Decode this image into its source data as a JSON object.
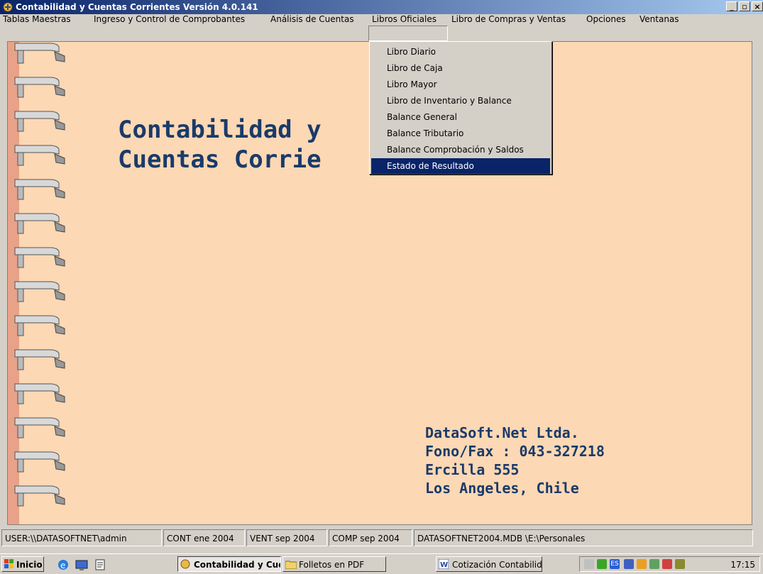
{
  "window": {
    "title": "Contabilidad y Cuentas Corrientes  Versión 4.0.141",
    "minimize": "_",
    "maximize": "▫",
    "close": "×"
  },
  "menubar": {
    "items": [
      "Tablas Maestras",
      "Ingreso y Control de Comprobantes",
      "Análisis de Cuentas",
      "Libros Oficiales",
      "Libro de Compras y Ventas",
      "Opciones",
      "Ventanas"
    ]
  },
  "dropdown": {
    "items": [
      "Libro Diario",
      "Libro de Caja",
      "Libro Mayor",
      "Libro de Inventario y Balance",
      "Balance General",
      "Balance Tributario",
      "Balance Comprobación y Saldos",
      "Estado de Resultado"
    ],
    "selected": "Estado de Resultado"
  },
  "main": {
    "heading_line1": "Contabilidad y",
    "heading_line2": "Cuentas Corrie",
    "company_lines": [
      "DataSoft.Net Ltda.",
      "Fono/Fax : 043-327218",
      "Ercilla 555",
      "Los Angeles, Chile"
    ]
  },
  "statusbar": {
    "panes": [
      "USER:\\\\DATASOFTNET\\admin",
      "CONT ene 2004",
      "VENT sep 2004",
      "COMP sep 2004",
      "DATASOFTNET2004.MDB \\E:\\Personales"
    ]
  },
  "taskbar": {
    "start": "Inicio",
    "buttons": [
      "Contabilidad y Cue...",
      "Folletos en PDF",
      "Cotización Contabilida..."
    ],
    "clock": "17:15"
  },
  "colors": {
    "background": "#fcd8b4",
    "heading": "#1a3a6a",
    "selection": "#0a246a"
  }
}
